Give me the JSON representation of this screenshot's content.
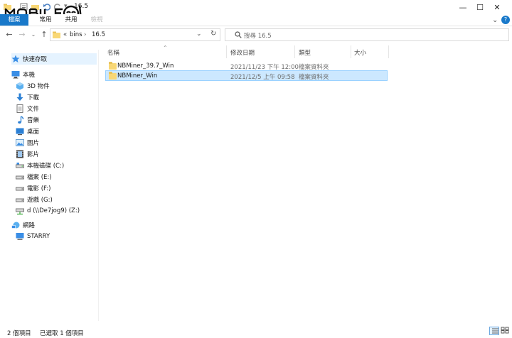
{
  "window": {
    "title": "16.5",
    "controls": {
      "minimize": "—",
      "maximize": "☐",
      "close": "✕"
    }
  },
  "ribbon": {
    "tabs": [
      "檔案",
      "常用",
      "共用",
      "檢視"
    ],
    "help": "?",
    "collapse": "⌄"
  },
  "address": {
    "overflow": "«",
    "path": [
      "bins",
      "16.5"
    ],
    "separator": "›"
  },
  "search": {
    "placeholder": "搜尋 16.5"
  },
  "sidebar": {
    "quick_access": "快速存取",
    "this_pc": "本機",
    "items": [
      {
        "label": "3D 物件",
        "icon": "3d-objects-icon"
      },
      {
        "label": "下載",
        "icon": "download-icon"
      },
      {
        "label": "文件",
        "icon": "document-icon"
      },
      {
        "label": "音樂",
        "icon": "music-icon"
      },
      {
        "label": "桌面",
        "icon": "desktop-icon"
      },
      {
        "label": "圖片",
        "icon": "pictures-icon"
      },
      {
        "label": "影片",
        "icon": "video-icon"
      },
      {
        "label": "本機磁碟 (C:)",
        "icon": "drive-icon"
      },
      {
        "label": "檔案 (E:)",
        "icon": "drive-icon"
      },
      {
        "label": "電影 (F:)",
        "icon": "drive-icon"
      },
      {
        "label": "遊戲 (G:)",
        "icon": "drive-icon"
      },
      {
        "label": "d (\\\\De7jog9) (Z:)",
        "icon": "network-drive-icon"
      }
    ],
    "network": "網路",
    "starry": "STARRY"
  },
  "columns": {
    "name": "名稱",
    "modified": "修改日期",
    "type": "類型",
    "size": "大小"
  },
  "files": [
    {
      "name": "NBMiner_39.7_Win",
      "modified": "2021/11/23 下午 12:00",
      "type": "檔案資料夾"
    },
    {
      "name": "NBMiner_Win",
      "modified": "2021/12/5 上午 09:58",
      "type": "檔案資料夾"
    }
  ],
  "status": {
    "count": "2 個項目",
    "selected": "已選取 1 個項目"
  },
  "colors": {
    "accent": "#1979ca",
    "selection": "#cce8ff",
    "folder": "#f8d775"
  }
}
